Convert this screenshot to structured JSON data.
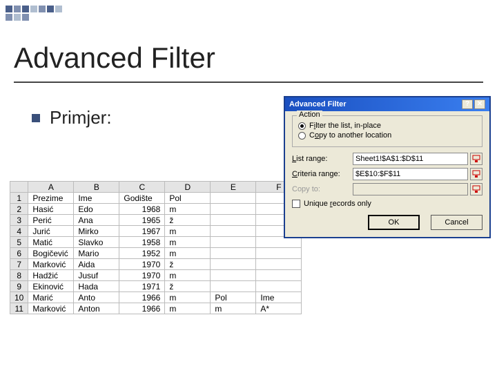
{
  "slide": {
    "title": "Advanced Filter",
    "bullet": "Primjer:"
  },
  "sheet": {
    "cols": [
      "A",
      "B",
      "C",
      "D",
      "E",
      "F"
    ],
    "rows": [
      {
        "n": "1",
        "A": "Prezime",
        "B": "Ime",
        "C": "Godište",
        "D": "Pol",
        "E": "",
        "F": ""
      },
      {
        "n": "2",
        "A": "Hasić",
        "B": "Edo",
        "C": "1968",
        "D": "m",
        "E": "",
        "F": ""
      },
      {
        "n": "3",
        "A": "Perić",
        "B": "Ana",
        "C": "1965",
        "D": "ž",
        "E": "",
        "F": ""
      },
      {
        "n": "4",
        "A": "Jurić",
        "B": "Mirko",
        "C": "1967",
        "D": "m",
        "E": "",
        "F": ""
      },
      {
        "n": "5",
        "A": "Matić",
        "B": "Slavko",
        "C": "1958",
        "D": "m",
        "E": "",
        "F": ""
      },
      {
        "n": "6",
        "A": "Bogičević",
        "B": "Mario",
        "C": "1952",
        "D": "m",
        "E": "",
        "F": ""
      },
      {
        "n": "7",
        "A": "Marković",
        "B": "Aida",
        "C": "1970",
        "D": "ž",
        "E": "",
        "F": ""
      },
      {
        "n": "8",
        "A": "Hadžić",
        "B": "Jusuf",
        "C": "1970",
        "D": "m",
        "E": "",
        "F": ""
      },
      {
        "n": "9",
        "A": "Ekinović",
        "B": "Hada",
        "C": "1971",
        "D": "ž",
        "E": "",
        "F": ""
      },
      {
        "n": "10",
        "A": "Marić",
        "B": "Anto",
        "C": "1966",
        "D": "m",
        "E": "Pol",
        "F": "Ime"
      },
      {
        "n": "11",
        "A": "Marković",
        "B": "Anton",
        "C": "1966",
        "D": "m",
        "E": "m",
        "F": "A*"
      }
    ]
  },
  "dialog": {
    "title": "Advanced Filter",
    "action": {
      "legend": "Action",
      "opt1_pre": "F",
      "opt1_mid": "i",
      "opt1_post": "lter the list, in-place",
      "opt2_pre": "C",
      "opt2_mid": "o",
      "opt2_post": "py to another location"
    },
    "list_range": {
      "pre": "L",
      "mid": "i",
      "post": "st range:",
      "value": "Sheet1!$A$1:$D$11"
    },
    "criteria_range": {
      "pre": "C",
      "mid": "r",
      "post": "iteria range:",
      "value": "$E$10:$F$11"
    },
    "copy_to": {
      "label": "Copy to:",
      "value": ""
    },
    "unique": {
      "pre": "Unique ",
      "mid": "r",
      "post": "ecords only"
    },
    "ok": "OK",
    "cancel": "Cancel"
  }
}
